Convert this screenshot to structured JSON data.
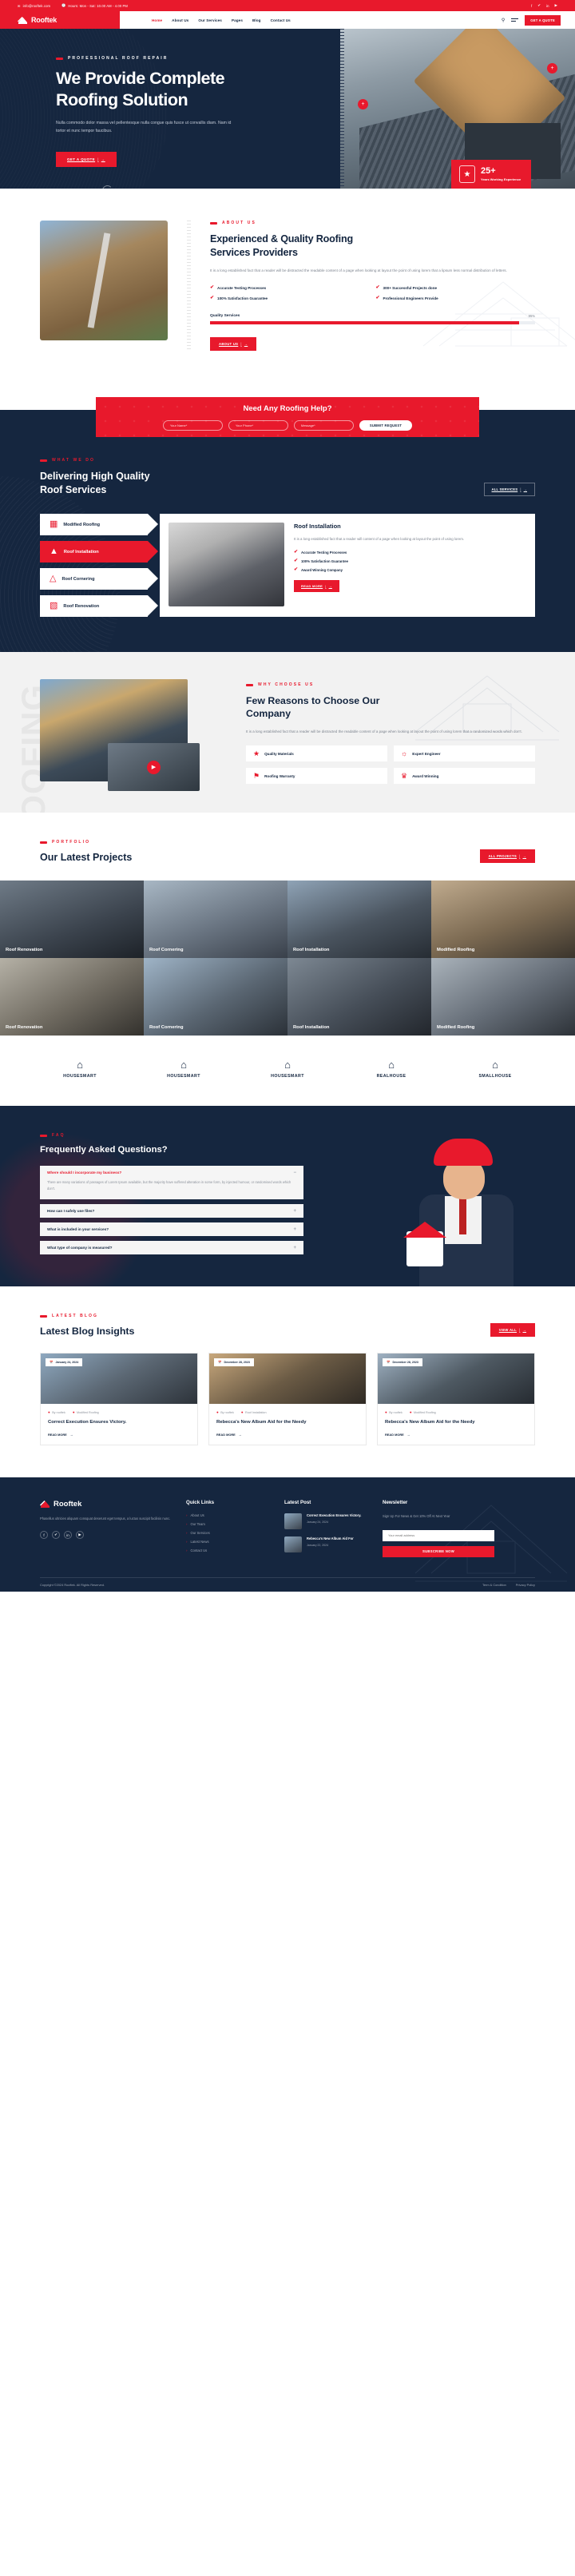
{
  "brand": {
    "name": "Rooftek",
    "accent": "#e8192c",
    "navy": "#15263f"
  },
  "topbar": {
    "email": "info@rooftek.com",
    "hours": "Hours: Mon - Sat: 10.00 AM - 4.00 PM",
    "email_icon": "envelope-icon",
    "hours_icon": "clock-icon",
    "socials": [
      {
        "name": "facebook-icon",
        "glyph": "f"
      },
      {
        "name": "twitter-icon",
        "glyph": "✔"
      },
      {
        "name": "linkedin-icon",
        "glyph": "in"
      },
      {
        "name": "youtube-icon",
        "glyph": "▶"
      }
    ]
  },
  "header": {
    "nav": [
      {
        "label": "Home",
        "active": true
      },
      {
        "label": "About Us",
        "active": false
      },
      {
        "label": "Our Services",
        "active": false
      },
      {
        "label": "Pages",
        "active": false
      },
      {
        "label": "Blog",
        "active": false
      },
      {
        "label": "Contact Us",
        "active": false
      }
    ],
    "search_icon": "search-icon",
    "menu_icon": "hamburger-icon",
    "quote_button": "GET A QUOTE"
  },
  "hero": {
    "kicker": "PROFESSIONAL ROOF REPAIR",
    "title_line1": "We Provide Complete",
    "title_line2": "Roofing Solution",
    "paragraph": "Nulla commodo dolor massa vel pellentesque nulla congue quis fusce ut convallis diam. Nam id tortor et nunc tempor faucibus.",
    "cta": "GET A QUOTE",
    "badge_number": "25+",
    "badge_label": "Years Working Experience",
    "badge_icon": "award-shield-icon"
  },
  "about": {
    "kicker": "ABOUT US",
    "title_line1": "Experienced & Quality Roofing",
    "title_line2": "Services Providers",
    "paragraph": "It is a long established fact that a reader will be distracted the readable content of a page when looking at layout the point of using lorem that a lipsum less normal distribution of letters.",
    "features": [
      "Accurate Testing Processes",
      "300+ Successful Projects done",
      "100% Satisfaction Guarantee",
      "Professional Engineers Provide"
    ],
    "progress_label": "Quality Services",
    "progress_value": "95%",
    "button": "ABOUT US"
  },
  "cta": {
    "title": "Need Any Roofing Help?",
    "name_placeholder": "Your Name*",
    "phone_placeholder": "Your Phone*",
    "message_placeholder": "Message*",
    "submit": "SUBMIT REQUEST"
  },
  "services": {
    "kicker": "WHAT WE DO",
    "title_line1": "Delivering High Quality",
    "title_line2": "Roof Services",
    "all_button": "ALL SERVICES",
    "tabs": [
      {
        "label": "Modified Roofing",
        "icon": "building-grid-icon",
        "active": false
      },
      {
        "label": "Roof Installation",
        "icon": "roof-worker-icon",
        "active": true
      },
      {
        "label": "Roof Cornering",
        "icon": "roof-corner-icon",
        "active": false
      },
      {
        "label": "Roof Renovation",
        "icon": "roof-renovation-icon",
        "active": false
      }
    ],
    "panel": {
      "title": "Roof Installation",
      "paragraph": "It is a long established fact that a reader will content of a page when looking at layout the point of using lorem.",
      "features": [
        "Accurate Testing Processes",
        "100% Satisfaction Guarantee",
        "Award Winning Company"
      ],
      "button": "READ MORE"
    }
  },
  "why": {
    "ghost_word": "ROOFING",
    "kicker": "WHY CHOOSE US",
    "title_line1": "Few Reasons to Choose Our",
    "title_line2": "Company",
    "paragraph": "It is a long established fact that a reader will be distracted the readable content of a page when looking at layout the point of using lorem that a randomized words which don't.",
    "play_icon": "play-icon",
    "cards": [
      {
        "label": "Quality Materials",
        "icon": "shield-check-icon"
      },
      {
        "label": "Expert Engineer",
        "icon": "engineer-icon"
      },
      {
        "label": "Roofing Warranty",
        "icon": "warranty-icon"
      },
      {
        "label": "Award Winning",
        "icon": "trophy-icon"
      }
    ]
  },
  "portfolio": {
    "kicker": "PORTFOLIO",
    "title": "Our Latest Projects",
    "all_button": "ALL PROJECTS",
    "items": [
      {
        "caption": "Roof Renovation"
      },
      {
        "caption": "Roof Cornering"
      },
      {
        "caption": "Roof Installation"
      },
      {
        "caption": "Modified Roofing"
      },
      {
        "caption": "Roof Renovation"
      },
      {
        "caption": "Roof Cornering"
      },
      {
        "caption": "Roof Installation"
      },
      {
        "caption": "Modified Roofing"
      }
    ]
  },
  "brands": [
    {
      "name": "HOUSESMART",
      "icon": "house-outline-icon"
    },
    {
      "name": "HOUSESMART",
      "icon": "house-outline-icon"
    },
    {
      "name": "HOUSESMART",
      "icon": "house-outline-icon"
    },
    {
      "name": "REALHOUSE",
      "icon": "house-outline-icon"
    },
    {
      "name": "SMALLHOUSE",
      "icon": "house-outline-icon"
    }
  ],
  "faq": {
    "kicker": "FAQ",
    "title": "Frequently Asked Questions?",
    "items": [
      {
        "q": "Where should I incorporate my business?",
        "a": "There are many variations of passages of Lorem Ipsum available, but the majority have suffered alteration in some form, by injected humour, or randomised words which don't.",
        "open": true,
        "toggle": "−"
      },
      {
        "q": "How can I safely use files?",
        "a": "",
        "open": false,
        "toggle": "+"
      },
      {
        "q": "What is included in your services?",
        "a": "",
        "open": false,
        "toggle": "+"
      },
      {
        "q": "What type of company is measured?",
        "a": "",
        "open": false,
        "toggle": "+"
      }
    ]
  },
  "blog": {
    "kicker": "LATEST BLOG",
    "title": "Latest Blog Insights",
    "view_all": "VIEW ALL",
    "posts": [
      {
        "date": "January 24, 2024",
        "author": "By rooftek",
        "category": "Modified Roofing",
        "title": "Correct Execution Ensures Victory.",
        "read_more": "READ MORE"
      },
      {
        "date": "December 28, 2023",
        "author": "By rooftek",
        "category": "Roof Installation",
        "title": "Rebecca's New Album Aid for the Needy",
        "read_more": "READ MORE"
      },
      {
        "date": "December 28, 2023",
        "author": "By rooftek",
        "category": "Modified Roofing",
        "title": "Rebecca's New Album Aid for the Needy",
        "read_more": "READ MORE"
      }
    ]
  },
  "footer": {
    "about": "Phasellus ultricies aliquam consquat deserunt eget tempus, a luctus suscipit facilisis nunc.",
    "socials": [
      {
        "name": "facebook-icon",
        "glyph": "f"
      },
      {
        "name": "twitter-icon",
        "glyph": "✔"
      },
      {
        "name": "linkedin-icon",
        "glyph": "in"
      },
      {
        "name": "youtube-icon",
        "glyph": "▶"
      }
    ],
    "quick_links_title": "Quick Links",
    "quick_links": [
      "About Us",
      "Our Team",
      "Our Services",
      "Latest News",
      "Contact Us"
    ],
    "latest_post_title": "Latest Post",
    "posts": [
      {
        "title": "Correct Execution Ensures Victory.",
        "date": "January 24, 2024"
      },
      {
        "title": "Rebecca's New Album Aid For",
        "date": "January 22, 2024"
      }
    ],
    "newsletter_title": "Newsletter",
    "newsletter_text": "Sign Up For News & Get 10% Off At Next Year",
    "email_placeholder": "Your email address",
    "subscribe": "SUBSCRIBE NOW",
    "copyright": "Copyright ©2024 Rooftek. All Rights Reserved.",
    "links": [
      "Term & Condition",
      "Privacy Policy"
    ]
  }
}
